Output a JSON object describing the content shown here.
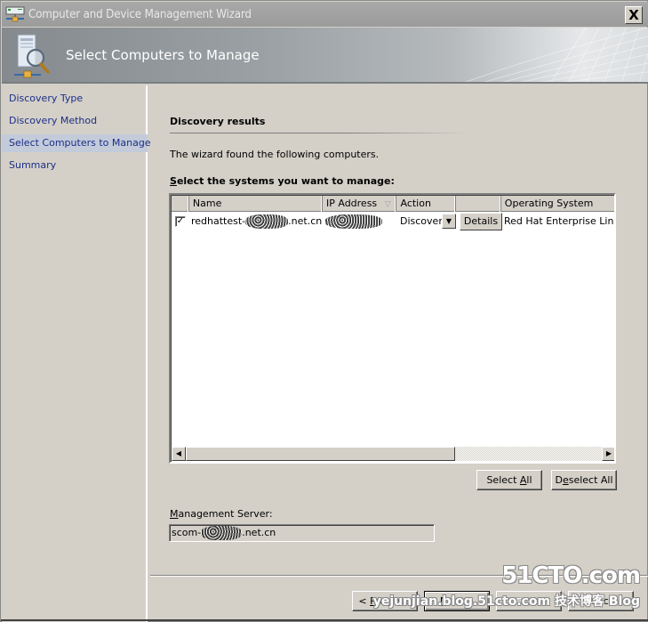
{
  "window": {
    "title": "Computer and Device Management Wizard",
    "close_label": "X"
  },
  "header": {
    "title": "Select Computers to Manage"
  },
  "nav": {
    "items": [
      {
        "label": "Discovery Type",
        "active": false
      },
      {
        "label": "Discovery Method",
        "active": false
      },
      {
        "label": "Select Computers to Manage",
        "active": true
      },
      {
        "label": "Summary",
        "active": false
      }
    ]
  },
  "content": {
    "section_heading": "Discovery results",
    "intro": "The wizard found the following computers.",
    "select_label_mnemonic": "S",
    "select_label_rest": "elect the systems you want to manage:",
    "list": {
      "columns": [
        "",
        "Name",
        "IP Address",
        "Action",
        "",
        "Operating System"
      ],
      "rows": [
        {
          "checked": true,
          "name_prefix": "redhattest-",
          "name_suffix": ".net.cn",
          "ip_address": "[redacted]",
          "action": "Discover",
          "details_label": "Details",
          "operating_system": "Red Hat Enterprise Linux E"
        }
      ]
    },
    "select_all_pre": "Select ",
    "select_all_mnemonic": "A",
    "select_all_post": "ll",
    "deselect_all_pre": "D",
    "deselect_all_mnemonic": "e",
    "deselect_all_post": "select All",
    "mgmt_label_mnemonic": "M",
    "mgmt_label_rest": "anagement Server:",
    "mgmt_server_prefix": "scom-",
    "mgmt_server_suffix": ".net.cn"
  },
  "footer": {
    "previous_pre": "< ",
    "previous_mnemonic": "P",
    "previous_post": "revious",
    "next_mnemonic": "N",
    "next_post": "ext >",
    "finish_label": "Finish",
    "cancel_label": "Cancel"
  },
  "watermark": {
    "brand": "51CTO.com",
    "sub": "yejunjian.blog.51cto.com  技术博客  Blog"
  }
}
